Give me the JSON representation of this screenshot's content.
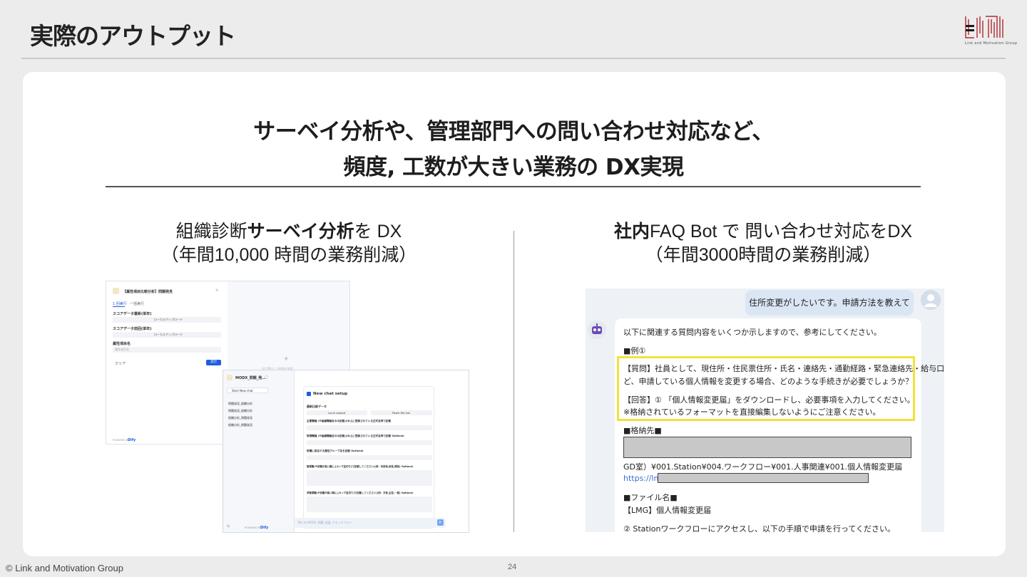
{
  "slide": {
    "title": "実際のアウトプット",
    "headline_line1": "サーベイ分析や、管理部門への問い合わせ対応など、",
    "headline_line2": "頻度, 工数が大きい業務の DX実現",
    "logo_text": "Link and Motivation Group",
    "footer_copyright": "© Link and Motivation Group",
    "page_number": "24"
  },
  "left": {
    "title_bold": "サーベイ分析",
    "title_pre": "組織診断",
    "title_post": "を DX",
    "subtitle": "（年間10,000 時間の業務削減）",
    "app1": {
      "header": "【属性項目比較分析】問題発見",
      "tab_active": "1 回実行",
      "tab_other": "一括実行",
      "field1_label": "スコアデータ最新(単年)",
      "field1_button": "ローカルアップロード",
      "field2_label": "スコアデータ前回(単年)",
      "field2_button": "ローカルアップロード",
      "field3_label": "属性項目名",
      "field3_placeholder": "属性項目名",
      "clear_label": "クリア",
      "run_label": "実行",
      "powered_by": "POWERED BY",
      "brand": "Dify",
      "empty_hint": "AIで実行して結果を取得"
    },
    "app2": {
      "title": "MODX_問題_発...",
      "new_chat": "Start New chat",
      "history": [
        "問題発見_組織分析",
        "問題発見_組織分析",
        "組織分析_問題発見",
        "組織分析_問題発見"
      ],
      "panel_title": "New chat setup",
      "section1": "最新比較データ",
      "local_upload": "Local upload",
      "paste_link": "Paste file link",
      "q1": "主要職種 (※組織職種名のみ記載)(ID上に登録されている正式名称で記載",
      "q2": "現場職種 (※組織職種名のみ記載)(ID上に登録されている正式名称で記載 Optional",
      "q3": "役職に該当する属性グループ名を記載 Optional",
      "q4": "管理職(※役職が高い順に,[カンマ区切り]で記載してください)(例：本部長,部長,課長) Optional",
      "q5": "非管理職(※役職が高い順に,[カンマ区切り]で記載してください)(例：次長,主任,一般) Optional",
      "chat_placeholder": "Talk to MODX_問題_発展_アキュチフロー",
      "powered_by": "POWERED BY",
      "brand": "Dify"
    }
  },
  "right": {
    "title_bold": "社内",
    "title_post": "FAQ Bot で 問い合わせ対応をDX",
    "subtitle": "（年間3000時間の業務削減）",
    "chat": {
      "user_message": "住所変更がしたいです。申請方法を教えてください。",
      "intro": "以下に関連する質問内容をいくつか示しますので、参考にしてください。",
      "example_heading": "■例①",
      "question_line1": "【質問】社員として、現住所・住民票住所・氏名・連絡先・通勤経路・緊急連絡先・給与口座な",
      "question_line2": "ど、申請している個人情報を変更する場合、どのような手続きが必要でしょうか？",
      "answer_line1": "【回答】① 「個人情報変更届」をダウンロードし、必要事項を入力してください。",
      "answer_line2": "※格納されているフォーマットを直接編集しないようにご注意ください。",
      "storage_heading": "■格納先■",
      "path": "GD室）¥001.Station¥004.ワークフロー¥001.人事関連¥001.個人情報変更届",
      "link_prefix": "https://lm",
      "filename_heading": "■ファイル名■",
      "filename": "【LMG】個人情報変更届",
      "step2": "② Stationワークフローにアクセスし、以下の手順で申請を行ってください。"
    }
  }
}
